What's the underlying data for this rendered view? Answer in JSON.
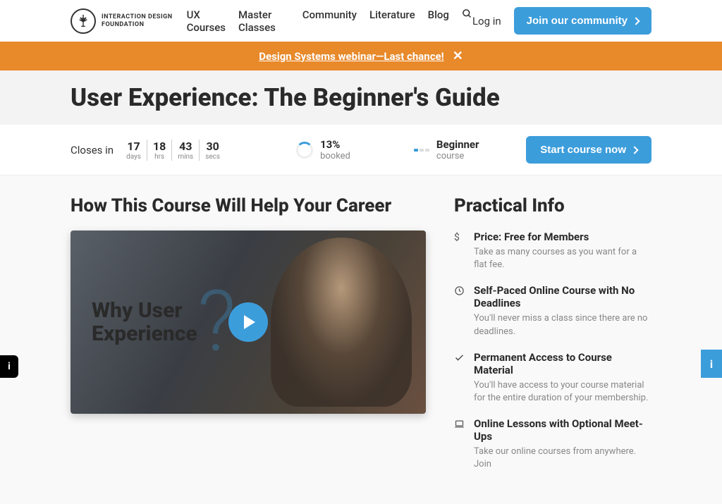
{
  "header": {
    "logo_line1": "INTERACTION DESIGN",
    "logo_line2": "FOUNDATION",
    "nav": [
      "UX Courses",
      "Master Classes",
      "Community",
      "Literature",
      "Blog"
    ],
    "login": "Log in",
    "join": "Join our community"
  },
  "banner": {
    "text": "Design Systems webinar—Last chance!"
  },
  "title": "User Experience: The Beginner's Guide",
  "info_bar": {
    "closes_label": "Closes in",
    "countdown": [
      {
        "num": "17",
        "label": "days"
      },
      {
        "num": "18",
        "label": "hrs"
      },
      {
        "num": "43",
        "label": "mins"
      },
      {
        "num": "30",
        "label": "secs"
      }
    ],
    "booked_pct": "13%",
    "booked_label": "booked",
    "level": "Beginner",
    "level_label": "course",
    "start": "Start course now"
  },
  "career": {
    "heading": "How This Course Will Help Your Career",
    "video_title_1": "Why User",
    "video_title_2": "Experience"
  },
  "practical": {
    "heading": "Practical Info",
    "items": [
      {
        "icon": "$",
        "title": "Price: Free for Members",
        "desc": "Take as many courses as you want for a flat fee."
      },
      {
        "icon": "clock",
        "title": "Self-Paced Online Course with No Deadlines",
        "desc": "You'll never miss a class since there are no deadlines."
      },
      {
        "icon": "check",
        "title": "Permanent Access to Course Material",
        "desc": "You'll have access to your course material for the entire duration of your membership."
      },
      {
        "icon": "laptop",
        "title": "Online Lessons with Optional Meet-Ups",
        "desc": "Take our online courses from anywhere. Join"
      }
    ]
  }
}
